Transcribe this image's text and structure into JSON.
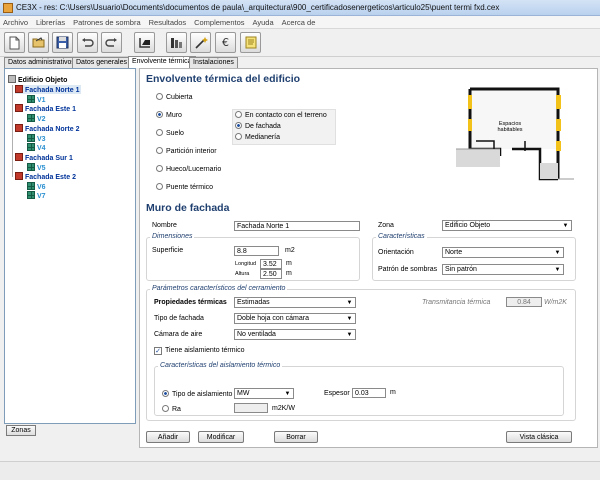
{
  "window": {
    "title": "CE3X - res: C:\\Users\\Usuario\\Documents\\documentos de paula\\_arquitectura\\900_certificadosenergeticos\\articulo25\\puent termi fxd.cex"
  },
  "menu": [
    "Archivo",
    "Librerías",
    "Patrones de sombra",
    "Resultados",
    "Complementos",
    "Ayuda",
    "Acerca de"
  ],
  "toolbar": {
    "icons": [
      "new-file-icon",
      "open-folder-icon",
      "save-icon",
      "undo-icon",
      "redo-icon",
      "import-icon",
      "bar-chart-icon",
      "wand-icon",
      "euro-icon",
      "notes-icon"
    ]
  },
  "tabs": [
    "Datos administrativos",
    "Datos generales",
    "Envolvente térmica",
    "Instalaciones"
  ],
  "active_tab": "Envolvente térmica",
  "tree": {
    "root": "Edificio Objeto",
    "groups": [
      {
        "label": "Fachada Norte 1",
        "children": [
          "V1"
        ]
      },
      {
        "label": "Fachada Este 1",
        "children": [
          "V2"
        ]
      },
      {
        "label": "Fachada Norte 2",
        "children": [
          "V3",
          "V4"
        ]
      },
      {
        "label": "Fachada Sur 1",
        "children": [
          "V5"
        ]
      },
      {
        "label": "Fachada Este 2",
        "children": [
          "V6",
          "V7"
        ]
      }
    ]
  },
  "zonas_button": "Zonas",
  "envolvente": {
    "title": "Envolvente térmica del edificio",
    "types": [
      "Cubierta",
      "Muro",
      "Suelo",
      "Partición interior",
      "Hueco/Lucernario",
      "Puente térmico"
    ],
    "selected_type": "Muro",
    "subtypes": [
      "En contacto con el terreno",
      "De fachada",
      "Medianería"
    ],
    "selected_subtype": "De fachada",
    "diagram_label": "Espacios habitables",
    "colors": {
      "highlight": "#f2c21a",
      "wall": "#111111"
    }
  },
  "muro": {
    "title": "Muro de fachada",
    "nombre_label": "Nombre",
    "nombre_value": "Fachada Norte 1",
    "zona_label": "Zona",
    "zona_value": "Edificio Objeto",
    "dimensiones": {
      "title": "Dimensiones",
      "superficie_label": "Superficie",
      "superficie_value": "8.8",
      "superficie_unit": "m2",
      "longitud_label": "Longitud",
      "longitud_value": "3.52",
      "longitud_unit": "m",
      "altura_label": "Altura",
      "altura_value": "2.50",
      "altura_unit": "m"
    },
    "caracteristicas": {
      "title": "Características",
      "orientacion_label": "Orientación",
      "orientacion_value": "Norte",
      "patron_label": "Patrón de sombras",
      "patron_value": "Sin patrón"
    },
    "parametros": {
      "title": "Parámetros característicos del cerramiento",
      "propiedades_label": "Propiedades térmicas",
      "propiedades_value": "Estimadas",
      "transmitancia_label": "Transmitancia térmica",
      "transmitancia_value": "0.84",
      "transmitancia_unit": "W/m2K",
      "tipo_fachada_label": "Tipo de fachada",
      "tipo_fachada_value": "Doble hoja con cámara",
      "camara_label": "Cámara de aire",
      "camara_value": "No ventilada",
      "aislamiento_check_label": "Tiene aislamiento térmico",
      "aislamiento_checked": true
    },
    "aislamiento": {
      "title": "Características del aislamiento térmico",
      "tipo_label": "Tipo de aislamiento",
      "tipo_value": "MW",
      "espesor_label": "Espesor",
      "espesor_value": "0.03",
      "espesor_unit": "m",
      "ra_label": "Ra",
      "ra_value": "",
      "ra_unit": "m2K/W",
      "selected": "Tipo de aislamiento"
    }
  },
  "actions": {
    "anadir": "Añadir",
    "modificar": "Modificar",
    "borrar": "Borrar",
    "vista": "Vista clásica"
  }
}
